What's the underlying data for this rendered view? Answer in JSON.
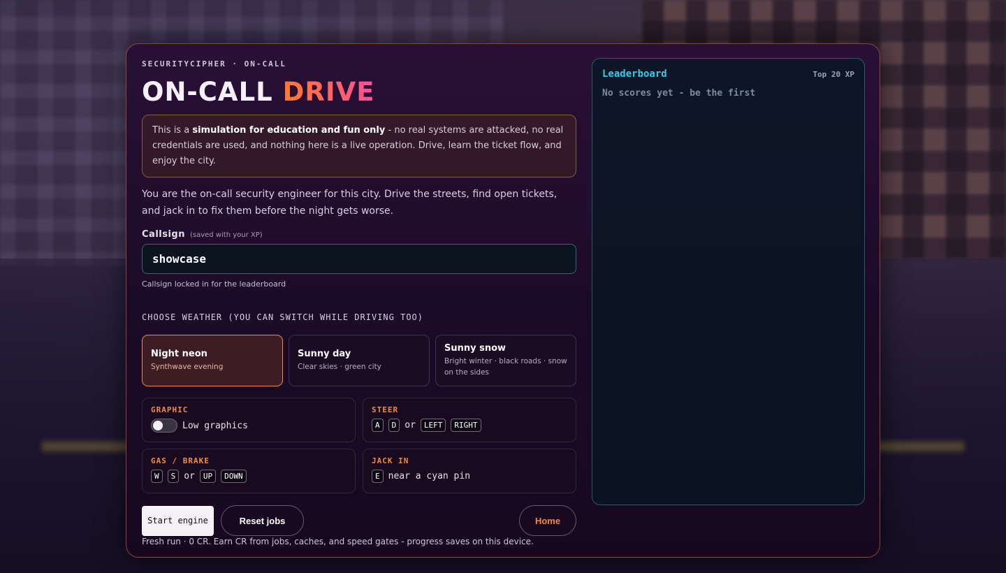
{
  "header": {
    "eyebrow": "SECURITYCIPHER · ON-CALL",
    "title_part1": "ON-CALL",
    "title_part2": "DRIVE"
  },
  "notice": {
    "prefix": "This is a ",
    "bold": "simulation for education and fun only",
    "rest": " - no real systems are attacked, no real credentials are used, and nothing here is a live operation. Drive, learn the ticket flow, and enjoy the city."
  },
  "intro": "You are the on-call security engineer for this city. Drive the streets, find open tickets, and jack in to fix them before the night gets worse.",
  "callsign": {
    "label": "Callsign",
    "hint": "(saved with your XP)",
    "value": "showcase",
    "status": "Callsign locked in for the leaderboard"
  },
  "weather": {
    "heading": "CHOOSE WEATHER (YOU CAN SWITCH WHILE DRIVING TOO)",
    "options": [
      {
        "name": "Night neon",
        "sub": "Synthwave evening",
        "selected": true
      },
      {
        "name": "Sunny day",
        "sub": "Clear skies · green city",
        "selected": false
      },
      {
        "name": "Sunny snow",
        "sub": "Bright winter · black roads · snow on the sides",
        "selected": false
      }
    ]
  },
  "controls": {
    "graphic": {
      "label": "GRAPHIC",
      "toggle_label": "Low graphics",
      "enabled": false
    },
    "steer": {
      "label": "STEER",
      "keys1": [
        "A",
        "D"
      ],
      "or": "or",
      "keys2": [
        "LEFT",
        "RIGHT"
      ]
    },
    "gas": {
      "label": "GAS / BRAKE",
      "keys1": [
        "W",
        "S"
      ],
      "or": "or",
      "keys2": [
        "UP",
        "DOWN"
      ]
    },
    "jack": {
      "label": "JACK IN",
      "key": "E",
      "text": "near a cyan pin"
    }
  },
  "actions": {
    "start": "Start engine",
    "reset": "Reset jobs",
    "home": "Home"
  },
  "run_info": "Fresh run · 0 CR. Earn CR from jobs, caches, and speed gates - progress saves on this device.",
  "leaderboard": {
    "title": "Leaderboard",
    "scope": "Top 20 XP",
    "empty": "No scores yet - be the first"
  },
  "colors": {
    "accent_orange": "#f08a44",
    "accent_cyan": "#2ad0ea",
    "title_gradient": [
      "#ff7a2e",
      "#ff4f9a"
    ]
  }
}
